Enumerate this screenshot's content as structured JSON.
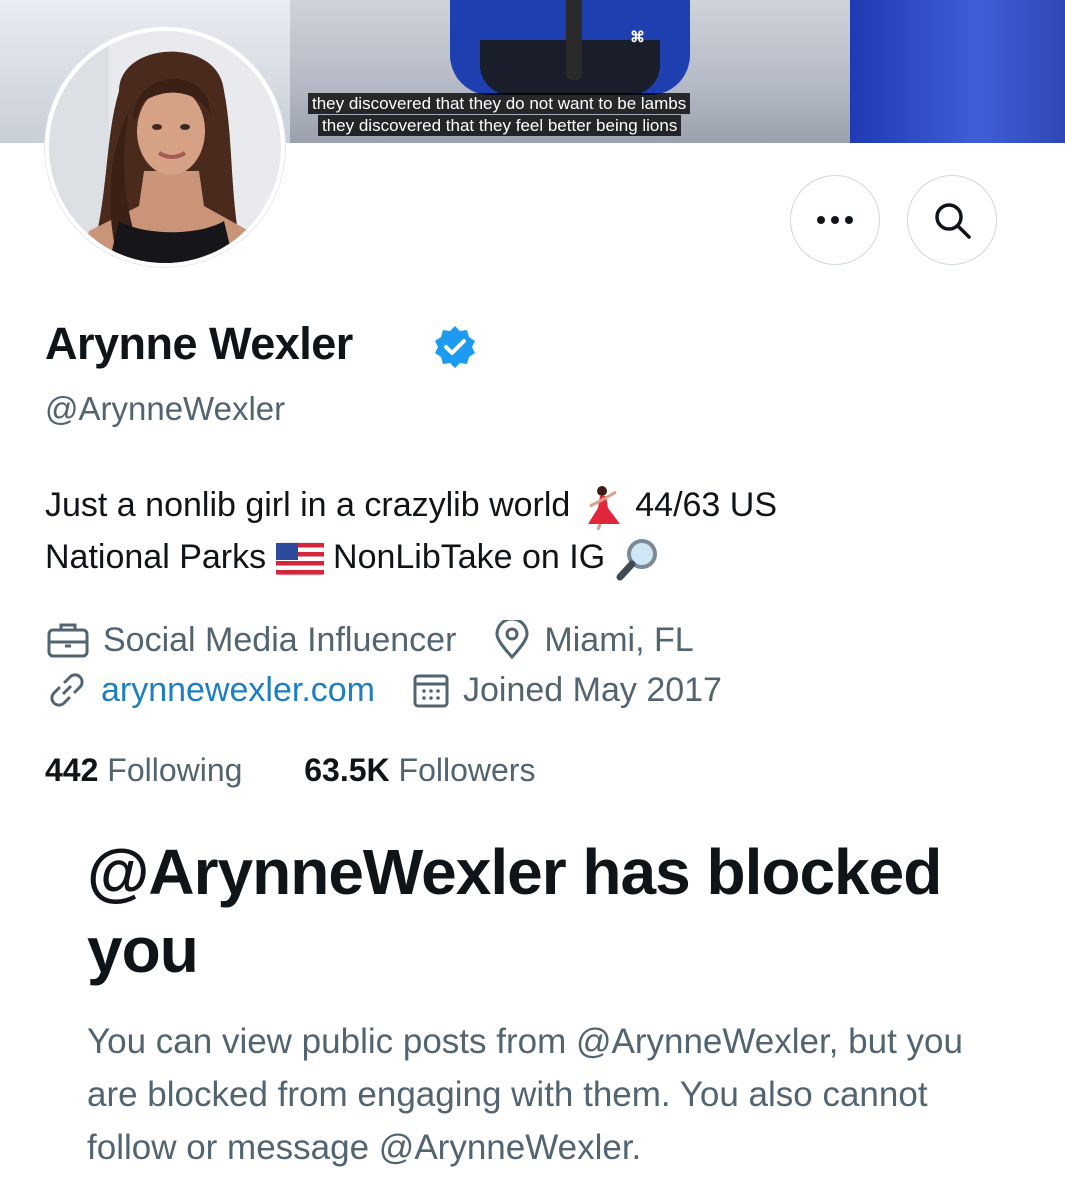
{
  "banner": {
    "caption_line1": "they discovered that they do not want to be lambs",
    "caption_line2": "they discovered that they feel better being lions"
  },
  "profile": {
    "display_name": "Arynne Wexler",
    "handle": "@ArynneWexler",
    "bio_line1_a": "Just a nonlib girl in a crazylib world",
    "bio_line1_b": "44/63 US",
    "bio_line2_a": "National Parks",
    "bio_line2_b": "NonLibTake on IG",
    "category": "Social Media Influencer",
    "location": "Miami, FL",
    "website": "arynnewexler.com",
    "joined": "Joined May 2017"
  },
  "stats": {
    "following_count": "442",
    "following_label": "Following",
    "followers_count": "63.5K",
    "followers_label": "Followers"
  },
  "blocked": {
    "title": "@ArynneWexler has blocked you",
    "description": "You can view public posts from @ArynneWexler, but you are blocked from engaging with them. You also cannot follow or message @ArynneWexler."
  },
  "icons": {
    "more": "more-horizontal-icon",
    "search": "search-icon",
    "verified": "verified-badge-icon",
    "category": "briefcase-icon",
    "location": "location-pin-icon",
    "website": "link-icon",
    "joined": "calendar-icon",
    "dancer_emoji": "dancer-emoji-icon",
    "flag_emoji": "us-flag-emoji-icon",
    "magnifier_emoji": "magnifying-glass-emoji-icon"
  },
  "colors": {
    "verified": "#1d9bf0",
    "link": "#1d7ec2",
    "secondary_text": "#536471",
    "primary_text": "#0f1419"
  }
}
